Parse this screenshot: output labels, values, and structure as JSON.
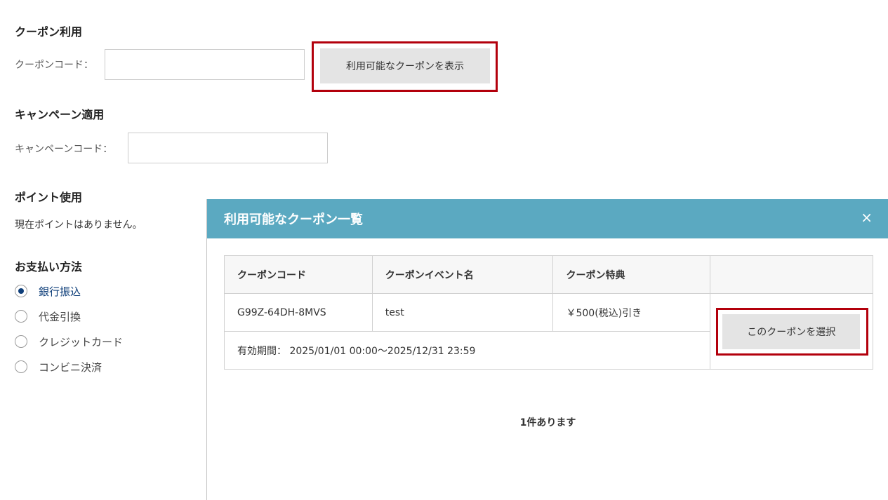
{
  "coupon": {
    "heading": "クーポン利用",
    "code_label": "クーポンコード：",
    "code_value": "",
    "show_button": "利用可能なクーポンを表示"
  },
  "campaign": {
    "heading": "キャンペーン適用",
    "code_label": "キャンペーンコード：",
    "code_value": ""
  },
  "points": {
    "heading": "ポイント使用",
    "message": "現在ポイントはありません。"
  },
  "payment": {
    "heading": "お支払い方法",
    "options": [
      {
        "label": "銀行振込",
        "selected": true
      },
      {
        "label": "代金引換",
        "selected": false
      },
      {
        "label": "クレジットカード",
        "selected": false
      },
      {
        "label": "コンビニ決済",
        "selected": false
      }
    ]
  },
  "modal": {
    "title": "利用可能なクーポン一覧",
    "close": "×",
    "headers": [
      "クーポンコード",
      "クーポンイベント名",
      "クーポン特典",
      ""
    ],
    "rows": [
      {
        "code": "G99Z-64DH-8MVS",
        "event": "test",
        "benefit": "￥500(税込)引き",
        "validity": "有効期間： 2025/01/01 00:00〜2025/12/31 23:59",
        "select_button": "このクーポンを選択"
      }
    ],
    "count_text": "1件あります"
  },
  "colors": {
    "modal_header": "#5ba9c1",
    "highlight": "#b3000c",
    "radio_selected": "#0f3f7a"
  }
}
